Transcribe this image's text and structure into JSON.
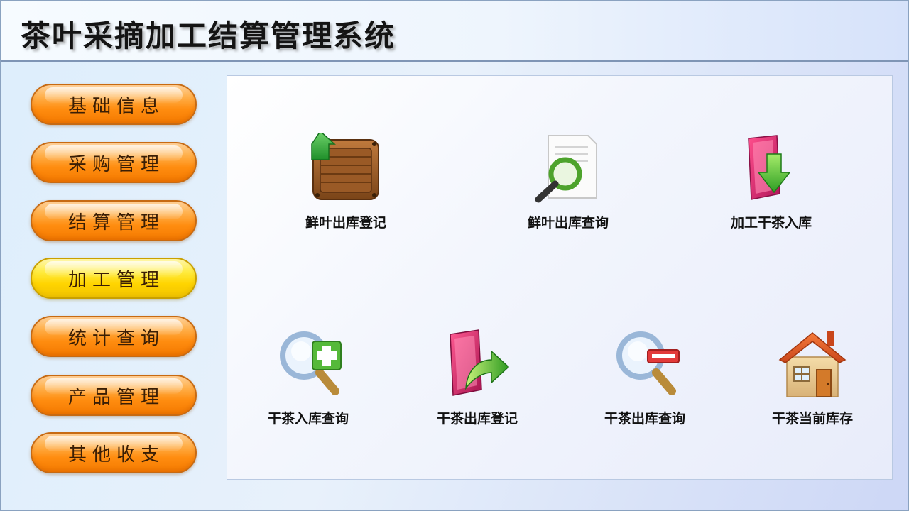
{
  "header": {
    "title": "茶叶采摘加工结算管理系统"
  },
  "sidebar": {
    "items": [
      {
        "label": "基础信息",
        "active": false
      },
      {
        "label": "采购管理",
        "active": false
      },
      {
        "label": "结算管理",
        "active": false
      },
      {
        "label": "加工管理",
        "active": true
      },
      {
        "label": "统计查询",
        "active": false
      },
      {
        "label": "产品管理",
        "active": false
      },
      {
        "label": "其他收支",
        "active": false
      }
    ]
  },
  "main": {
    "tiles": [
      {
        "label": "鲜叶出库登记",
        "icon": "wooden-crate-upload-icon"
      },
      {
        "label": "鲜叶出库查询",
        "icon": "document-search-icon"
      },
      {
        "label": "加工干茶入库",
        "icon": "folder-download-icon"
      },
      {
        "label": "干茶入库查询",
        "icon": "search-plus-icon"
      },
      {
        "label": "干茶出库登记",
        "icon": "folder-export-icon"
      },
      {
        "label": "干茶出库查询",
        "icon": "search-minus-icon"
      },
      {
        "label": "干茶当前库存",
        "icon": "house-icon"
      }
    ]
  },
  "colors": {
    "button_orange": "#ff8d10",
    "button_active_yellow": "#ffd400",
    "menu_text": "#3a1e05"
  }
}
